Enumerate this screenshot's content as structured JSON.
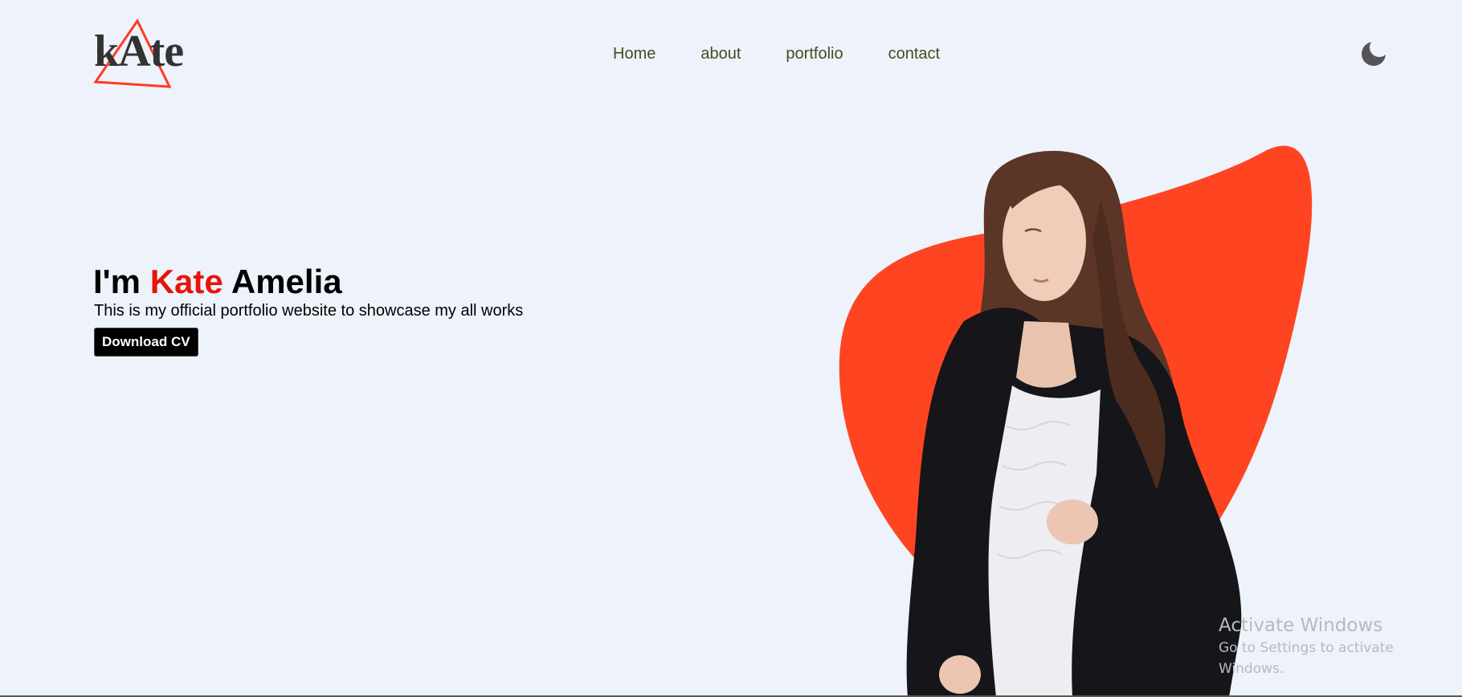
{
  "brand": {
    "logo_text": "kAte",
    "logo_triangle_color": "#ff3b1f"
  },
  "nav": {
    "items": [
      {
        "label": "Home"
      },
      {
        "label": "about"
      },
      {
        "label": "portfolio"
      },
      {
        "label": "contact"
      }
    ]
  },
  "theme_toggle": {
    "icon": "moon-icon"
  },
  "hero": {
    "title_prefix": "I'm",
    "title_first_name": "Kate",
    "title_last_name": "Amelia",
    "subtitle": "This is my official portfolio website to showcase my all works",
    "cta_label": "Download CV",
    "accent_color": "#e8140c",
    "blob_color": "#ff4422"
  },
  "system_overlay": {
    "title": "Activate Windows",
    "subtitle": "Go to Settings to activate Windows."
  }
}
